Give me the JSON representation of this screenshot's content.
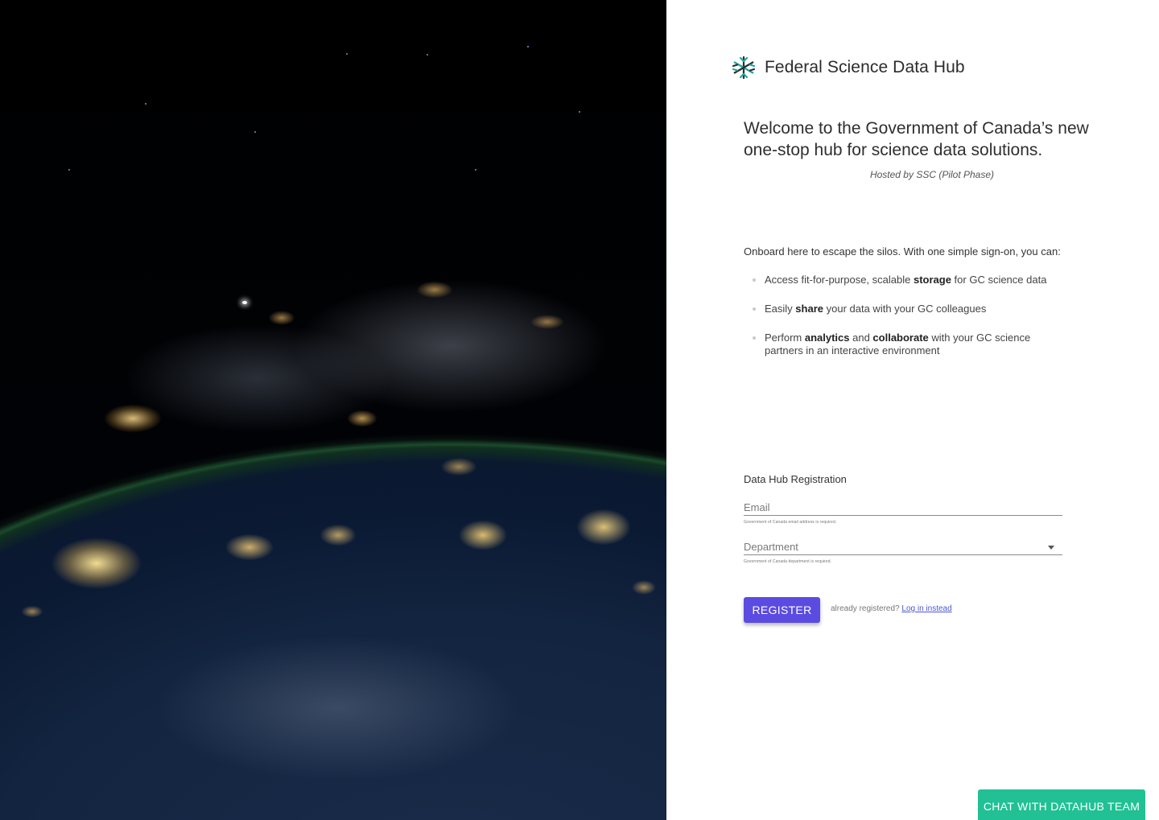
{
  "hero": {
    "image_alt": "Earth at night from orbit"
  },
  "brand": {
    "name": "Federal Science Data Hub",
    "logo_icon": "snowflake-data-icon"
  },
  "welcome": {
    "headline": "Welcome to the Government of Canada’s new one-stop hub for science data solutions.",
    "hosted_by": "Hosted by SSC (Pilot Phase)"
  },
  "intro": "Onboard here to escape the silos. With one simple sign-on, you can:",
  "benefits": [
    {
      "pre": "Access fit-for-purpose, scalable ",
      "b1": "storage",
      "mid": " for GC science data",
      "b2": "",
      "post": ""
    },
    {
      "pre": "Easily ",
      "b1": "share",
      "mid": " your data with your GC colleagues",
      "b2": "",
      "post": ""
    },
    {
      "pre": "Perform ",
      "b1": "analytics",
      "mid": " and ",
      "b2": "collaborate",
      "post": " with your GC science partners in an interactive environment"
    }
  ],
  "registration": {
    "title": "Data Hub Registration",
    "email_placeholder": "Email",
    "email_helper": "Government of Canada email address is required.",
    "department_value": "Department",
    "department_helper": "Government of Canada department is required.",
    "register_label": "REGISTER",
    "already_text": "already registered?",
    "login_link": "Log in instead"
  },
  "chat": {
    "label": "CHAT WITH DATAHUB TEAM"
  },
  "colors": {
    "primary": "#5c4be0",
    "chat": "#21c095",
    "link": "#4a57d6",
    "logo_teal": "#1aa6a6",
    "logo_dark": "#2b2b2b"
  }
}
